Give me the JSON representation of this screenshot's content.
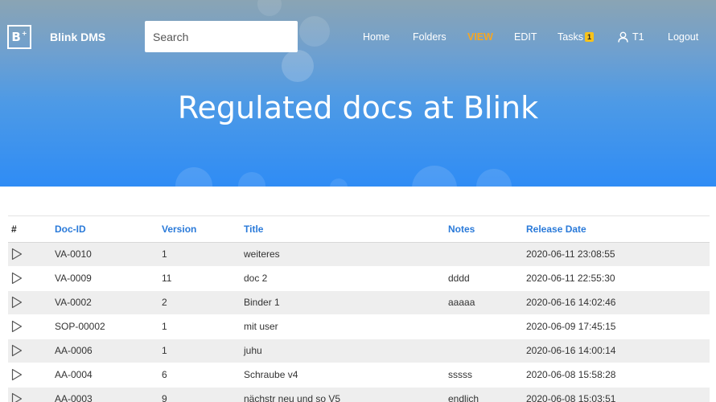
{
  "header": {
    "logo_letter": "B",
    "logo_sup": "+",
    "brand": "Blink DMS",
    "search_placeholder": "Search",
    "nav": {
      "home": "Home",
      "folders": "Folders",
      "view": "VIEW",
      "edit": "EDIT",
      "tasks": "Tasks",
      "tasks_count": "1",
      "user": "T1",
      "logout": "Logout"
    },
    "accent_color": "#f5a623",
    "badge_color": "#f7c21b"
  },
  "hero": {
    "title": "Regulated docs at Blink"
  },
  "table": {
    "columns": [
      "#",
      "Doc-ID",
      "Version",
      "Title",
      "Notes",
      "Release Date"
    ],
    "rows": [
      {
        "doc_id": "VA-0010",
        "version": "1",
        "title": "weiteres",
        "notes": "",
        "release": "2020-06-11 23:08:55"
      },
      {
        "doc_id": "VA-0009",
        "version": "11",
        "title": "doc 2",
        "notes": "dddd",
        "release": "2020-06-11 22:55:30"
      },
      {
        "doc_id": "VA-0002",
        "version": "2",
        "title": "Binder 1",
        "notes": "aaaaa",
        "release": "2020-06-16 14:02:46"
      },
      {
        "doc_id": "SOP-00002",
        "version": "1",
        "title": "mit user",
        "notes": "",
        "release": "2020-06-09 17:45:15"
      },
      {
        "doc_id": "AA-0006",
        "version": "1",
        "title": "juhu",
        "notes": "",
        "release": "2020-06-16 14:00:14"
      },
      {
        "doc_id": "AA-0004",
        "version": "6",
        "title": "Schraube v4",
        "notes": "sssss",
        "release": "2020-06-08 15:58:28"
      },
      {
        "doc_id": "AA-0003",
        "version": "9",
        "title": "nächstr neu und so V5",
        "notes": "endlich",
        "release": "2020-06-08 15:03:51"
      }
    ]
  }
}
